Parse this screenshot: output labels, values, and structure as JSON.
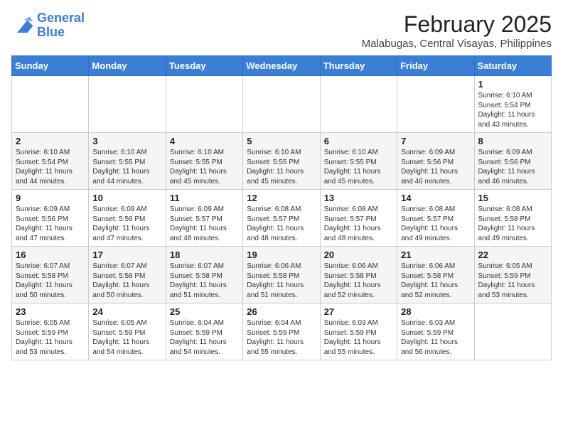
{
  "logo": {
    "line1": "General",
    "line2": "Blue"
  },
  "title": "February 2025",
  "subtitle": "Malabugas, Central Visayas, Philippines",
  "weekdays": [
    "Sunday",
    "Monday",
    "Tuesday",
    "Wednesday",
    "Thursday",
    "Friday",
    "Saturday"
  ],
  "weeks": [
    [
      {
        "day": "",
        "info": ""
      },
      {
        "day": "",
        "info": ""
      },
      {
        "day": "",
        "info": ""
      },
      {
        "day": "",
        "info": ""
      },
      {
        "day": "",
        "info": ""
      },
      {
        "day": "",
        "info": ""
      },
      {
        "day": "1",
        "info": "Sunrise: 6:10 AM\nSunset: 5:54 PM\nDaylight: 11 hours\nand 43 minutes."
      }
    ],
    [
      {
        "day": "2",
        "info": "Sunrise: 6:10 AM\nSunset: 5:54 PM\nDaylight: 11 hours\nand 44 minutes."
      },
      {
        "day": "3",
        "info": "Sunrise: 6:10 AM\nSunset: 5:55 PM\nDaylight: 11 hours\nand 44 minutes."
      },
      {
        "day": "4",
        "info": "Sunrise: 6:10 AM\nSunset: 5:55 PM\nDaylight: 11 hours\nand 45 minutes."
      },
      {
        "day": "5",
        "info": "Sunrise: 6:10 AM\nSunset: 5:55 PM\nDaylight: 11 hours\nand 45 minutes."
      },
      {
        "day": "6",
        "info": "Sunrise: 6:10 AM\nSunset: 5:55 PM\nDaylight: 11 hours\nand 45 minutes."
      },
      {
        "day": "7",
        "info": "Sunrise: 6:09 AM\nSunset: 5:56 PM\nDaylight: 11 hours\nand 46 minutes."
      },
      {
        "day": "8",
        "info": "Sunrise: 6:09 AM\nSunset: 5:56 PM\nDaylight: 11 hours\nand 46 minutes."
      }
    ],
    [
      {
        "day": "9",
        "info": "Sunrise: 6:09 AM\nSunset: 5:56 PM\nDaylight: 11 hours\nand 47 minutes."
      },
      {
        "day": "10",
        "info": "Sunrise: 6:09 AM\nSunset: 5:56 PM\nDaylight: 11 hours\nand 47 minutes."
      },
      {
        "day": "11",
        "info": "Sunrise: 6:09 AM\nSunset: 5:57 PM\nDaylight: 11 hours\nand 48 minutes."
      },
      {
        "day": "12",
        "info": "Sunrise: 6:08 AM\nSunset: 5:57 PM\nDaylight: 11 hours\nand 48 minutes."
      },
      {
        "day": "13",
        "info": "Sunrise: 6:08 AM\nSunset: 5:57 PM\nDaylight: 11 hours\nand 48 minutes."
      },
      {
        "day": "14",
        "info": "Sunrise: 6:08 AM\nSunset: 5:57 PM\nDaylight: 11 hours\nand 49 minutes."
      },
      {
        "day": "15",
        "info": "Sunrise: 6:08 AM\nSunset: 5:58 PM\nDaylight: 11 hours\nand 49 minutes."
      }
    ],
    [
      {
        "day": "16",
        "info": "Sunrise: 6:07 AM\nSunset: 5:58 PM\nDaylight: 11 hours\nand 50 minutes."
      },
      {
        "day": "17",
        "info": "Sunrise: 6:07 AM\nSunset: 5:58 PM\nDaylight: 11 hours\nand 50 minutes."
      },
      {
        "day": "18",
        "info": "Sunrise: 6:07 AM\nSunset: 5:58 PM\nDaylight: 11 hours\nand 51 minutes."
      },
      {
        "day": "19",
        "info": "Sunrise: 6:06 AM\nSunset: 5:58 PM\nDaylight: 11 hours\nand 51 minutes."
      },
      {
        "day": "20",
        "info": "Sunrise: 6:06 AM\nSunset: 5:58 PM\nDaylight: 11 hours\nand 52 minutes."
      },
      {
        "day": "21",
        "info": "Sunrise: 6:06 AM\nSunset: 5:58 PM\nDaylight: 11 hours\nand 52 minutes."
      },
      {
        "day": "22",
        "info": "Sunrise: 6:05 AM\nSunset: 5:59 PM\nDaylight: 11 hours\nand 53 minutes."
      }
    ],
    [
      {
        "day": "23",
        "info": "Sunrise: 6:05 AM\nSunset: 5:59 PM\nDaylight: 11 hours\nand 53 minutes."
      },
      {
        "day": "24",
        "info": "Sunrise: 6:05 AM\nSunset: 5:59 PM\nDaylight: 11 hours\nand 54 minutes."
      },
      {
        "day": "25",
        "info": "Sunrise: 6:04 AM\nSunset: 5:59 PM\nDaylight: 11 hours\nand 54 minutes."
      },
      {
        "day": "26",
        "info": "Sunrise: 6:04 AM\nSunset: 5:59 PM\nDaylight: 11 hours\nand 55 minutes."
      },
      {
        "day": "27",
        "info": "Sunrise: 6:03 AM\nSunset: 5:59 PM\nDaylight: 11 hours\nand 55 minutes."
      },
      {
        "day": "28",
        "info": "Sunrise: 6:03 AM\nSunset: 5:59 PM\nDaylight: 11 hours\nand 56 minutes."
      },
      {
        "day": "",
        "info": ""
      }
    ]
  ]
}
